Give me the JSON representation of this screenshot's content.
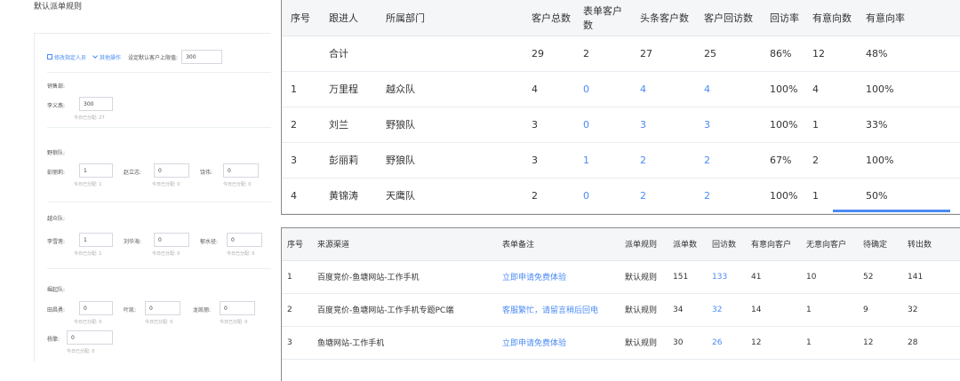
{
  "left": {
    "title": "默认派单规则",
    "toolbar": {
      "edit_link": "修改指定人员",
      "more_link": "其他操作",
      "limit_label": "设定默认客户上限值:",
      "limit_value": "300"
    },
    "groups": [
      {
        "name": "销售部:",
        "people": [
          {
            "name": "李义燕:",
            "value": "300",
            "assigned": "今日已分配: 27"
          }
        ]
      },
      {
        "name": "野狼队:",
        "people": [
          {
            "name": "彭丽莉:",
            "value": "1",
            "assigned": "今日已分配: 1"
          },
          {
            "name": "赵立志:",
            "value": "0",
            "assigned": "今日已分配: 0"
          },
          {
            "name": "饶伟:",
            "value": "0",
            "assigned": "今日已分配: 0"
          }
        ]
      },
      {
        "name": "越众队:",
        "people": [
          {
            "name": "李雪莲:",
            "value": "1",
            "assigned": "今日已分配: 1"
          },
          {
            "name": "刘华海:",
            "value": "0",
            "assigned": "今日已分配: 0"
          },
          {
            "name": "郁水径:",
            "value": "0",
            "assigned": "今日已分配: 0"
          }
        ]
      },
      {
        "name": "崛起队:",
        "people": [
          {
            "name": "田昌勇:",
            "value": "0",
            "assigned": "今日已分配: 0"
          },
          {
            "name": "叶凯:",
            "value": "0",
            "assigned": "今日已分配: 0"
          },
          {
            "name": "龙凯丽:",
            "value": "0",
            "assigned": "今日已分配: 0"
          },
          {
            "name": "杨擎:",
            "value": "0",
            "assigned": "今日已分配: 0"
          }
        ]
      }
    ]
  },
  "table1": {
    "headers": [
      "序号",
      "跟进人",
      "所属部门",
      "客户总数",
      "表单客户数",
      "头条客户数",
      "客户回访数",
      "回访率",
      "有意向数",
      "有意向率"
    ],
    "total": [
      "",
      "合计",
      "",
      "29",
      "2",
      "27",
      "25",
      "86%",
      "12",
      "48%"
    ],
    "rows": [
      [
        "1",
        "万里程",
        "越众队",
        "4",
        "0",
        "4",
        "4",
        "100%",
        "4",
        "100%"
      ],
      [
        "2",
        "刘兰",
        "野狼队",
        "3",
        "0",
        "3",
        "3",
        "100%",
        "1",
        "33%"
      ],
      [
        "3",
        "彭丽莉",
        "野狼队",
        "3",
        "1",
        "2",
        "2",
        "67%",
        "2",
        "100%"
      ],
      [
        "4",
        "黄锦涛",
        "天鹰队",
        "2",
        "0",
        "2",
        "2",
        "100%",
        "1",
        "50%"
      ]
    ],
    "accent": "#4a8af4"
  },
  "table2": {
    "headers": [
      "序号",
      "来源渠道",
      "表单备注",
      "派单规则",
      "派单数",
      "回访数",
      "有意向客户",
      "无意向客户",
      "待确定",
      "转出数"
    ],
    "rows": [
      [
        "1",
        "百度竞价-鱼塘网站-工作手机",
        "立即申请免费体验",
        "默认规则",
        "151",
        "133",
        "41",
        "10",
        "52",
        "141"
      ],
      [
        "2",
        "百度竞价-鱼塘网站-工作手机专题PC端",
        "客服繁忙，请留言稍后回电",
        "默认规则",
        "34",
        "32",
        "14",
        "1",
        "9",
        "32"
      ],
      [
        "3",
        "鱼塘网站-工作手机",
        "立即申请免费体验",
        "默认规则",
        "30",
        "26",
        "12",
        "1",
        "12",
        "28"
      ]
    ]
  }
}
